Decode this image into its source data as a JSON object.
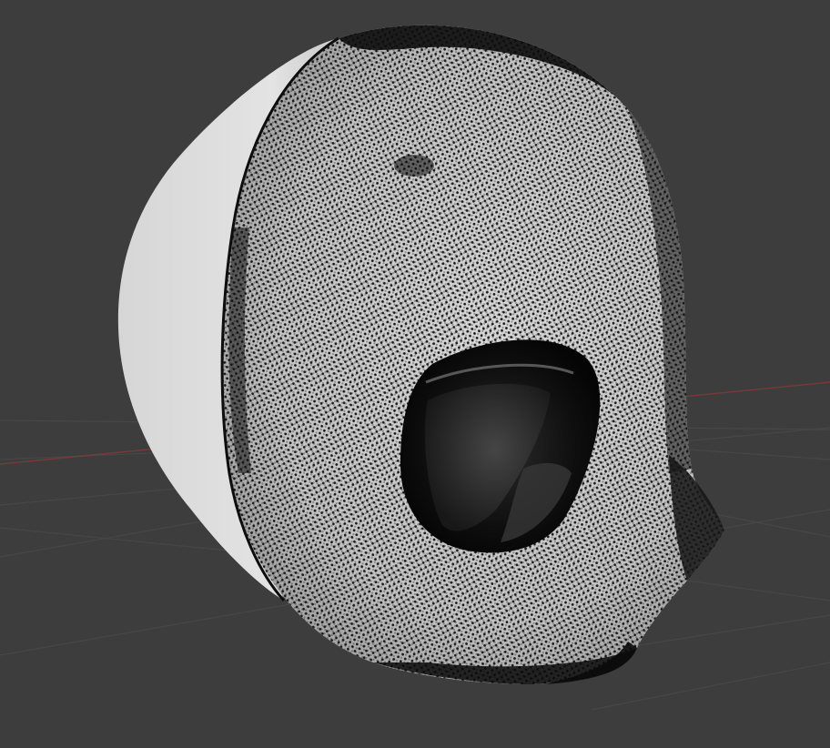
{
  "viewport": {
    "background_color": "#3d3d3d",
    "grid_color": "#474747",
    "x_axis_color": "#9a3d3d"
  },
  "mesh": {
    "object_type": "mask-mesh",
    "shading": "solid",
    "vertex_display": "on",
    "surface_color": "#cfcfcf",
    "vertex_color": "#111111",
    "shadow_color": "#0b0b0b"
  }
}
